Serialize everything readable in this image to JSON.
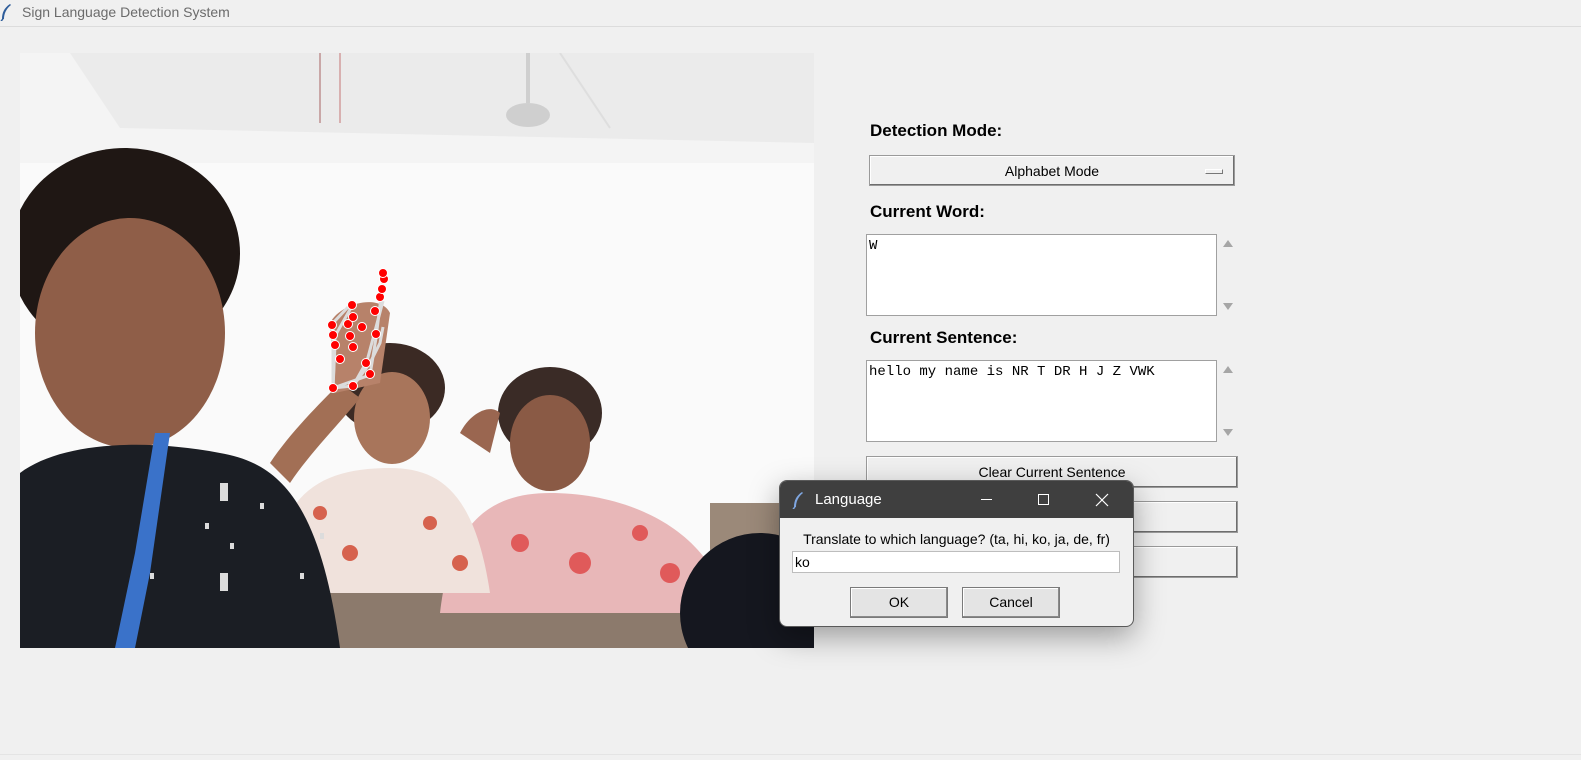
{
  "window": {
    "title": "Sign Language Detection System",
    "icon": "feather-icon"
  },
  "camera": {
    "description_icon": "webcam-feed"
  },
  "panel": {
    "detection_mode_label": "Detection Mode:",
    "detection_mode_value": "Alphabet Mode",
    "current_word_label": "Current Word:",
    "current_word_value": "W",
    "current_sentence_label": "Current Sentence:",
    "current_sentence_value": "hello my name is NR T DR H J Z VWK",
    "clear_button_label": "Clear Current Sentence"
  },
  "dialog": {
    "title": "Language",
    "prompt": "Translate to which language? (ta, hi, ko, ja, de, fr)",
    "input_value": "ko",
    "ok_label": "OK",
    "cancel_label": "Cancel"
  },
  "colors": {
    "landmark": "#ff0000",
    "dialog_titlebar": "#3f3f3f",
    "background": "#f0f0f0"
  }
}
